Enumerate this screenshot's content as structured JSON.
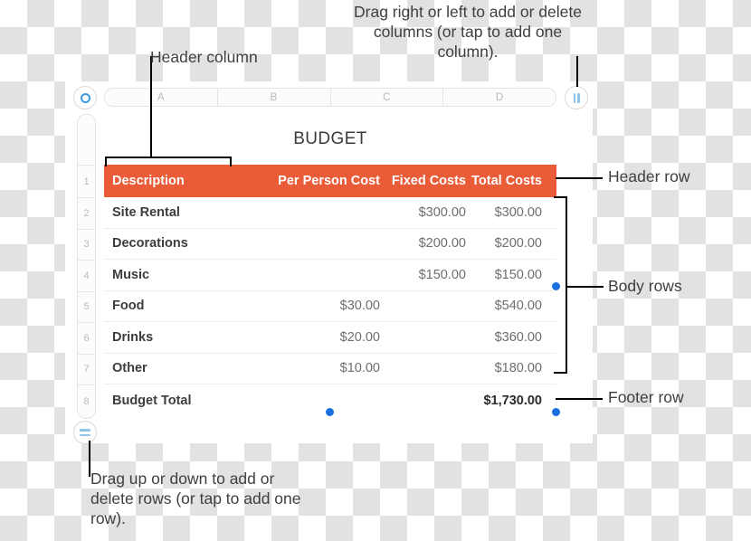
{
  "app": {
    "kind": "spreadsheet-table-illustration"
  },
  "column_headers": [
    "A",
    "B",
    "C",
    "D"
  ],
  "row_numbers": [
    "",
    "1",
    "2",
    "3",
    "4",
    "5",
    "6",
    "7",
    "8"
  ],
  "handles": {
    "column_left_icon": "ring-icon",
    "column_right_icon": "vertical-bars-icon",
    "row_bottom_icon": "horizontal-bars-icon"
  },
  "table": {
    "title": "BUDGET",
    "header": {
      "description": "Description",
      "per_person_cost": "Per Person Cost",
      "fixed_costs": "Fixed Costs",
      "total_costs": "Total Costs"
    },
    "rows": [
      {
        "description": "Site Rental",
        "per_person": "",
        "fixed": "$300.00",
        "total": "$300.00"
      },
      {
        "description": "Decorations",
        "per_person": "",
        "fixed": "$200.00",
        "total": "$200.00"
      },
      {
        "description": "Music",
        "per_person": "",
        "fixed": "$150.00",
        "total": "$150.00"
      },
      {
        "description": "Food",
        "per_person": "$30.00",
        "fixed": "",
        "total": "$540.00"
      },
      {
        "description": "Drinks",
        "per_person": "$20.00",
        "fixed": "",
        "total": "$360.00"
      },
      {
        "description": "Other",
        "per_person": "$10.00",
        "fixed": "",
        "total": "$180.00"
      }
    ],
    "footer": {
      "description": "Budget Total",
      "per_person": "",
      "fixed": "",
      "total": "$1,730.00"
    }
  },
  "callouts": {
    "columns": "Drag right or left to add or delete columns (or tap to add one column).",
    "header_column": "Header column",
    "header_row": "Header row",
    "body_rows": "Body rows",
    "footer_row": "Footer row",
    "rows": "Drag up or down to add or delete rows (or tap to add one row)."
  },
  "colors": {
    "header_orange": "#ea5b38",
    "selection_blue": "#1a6fe0",
    "handle_icon_blue": "#3d9ae0",
    "annotation_text": "#3f3f3f"
  }
}
